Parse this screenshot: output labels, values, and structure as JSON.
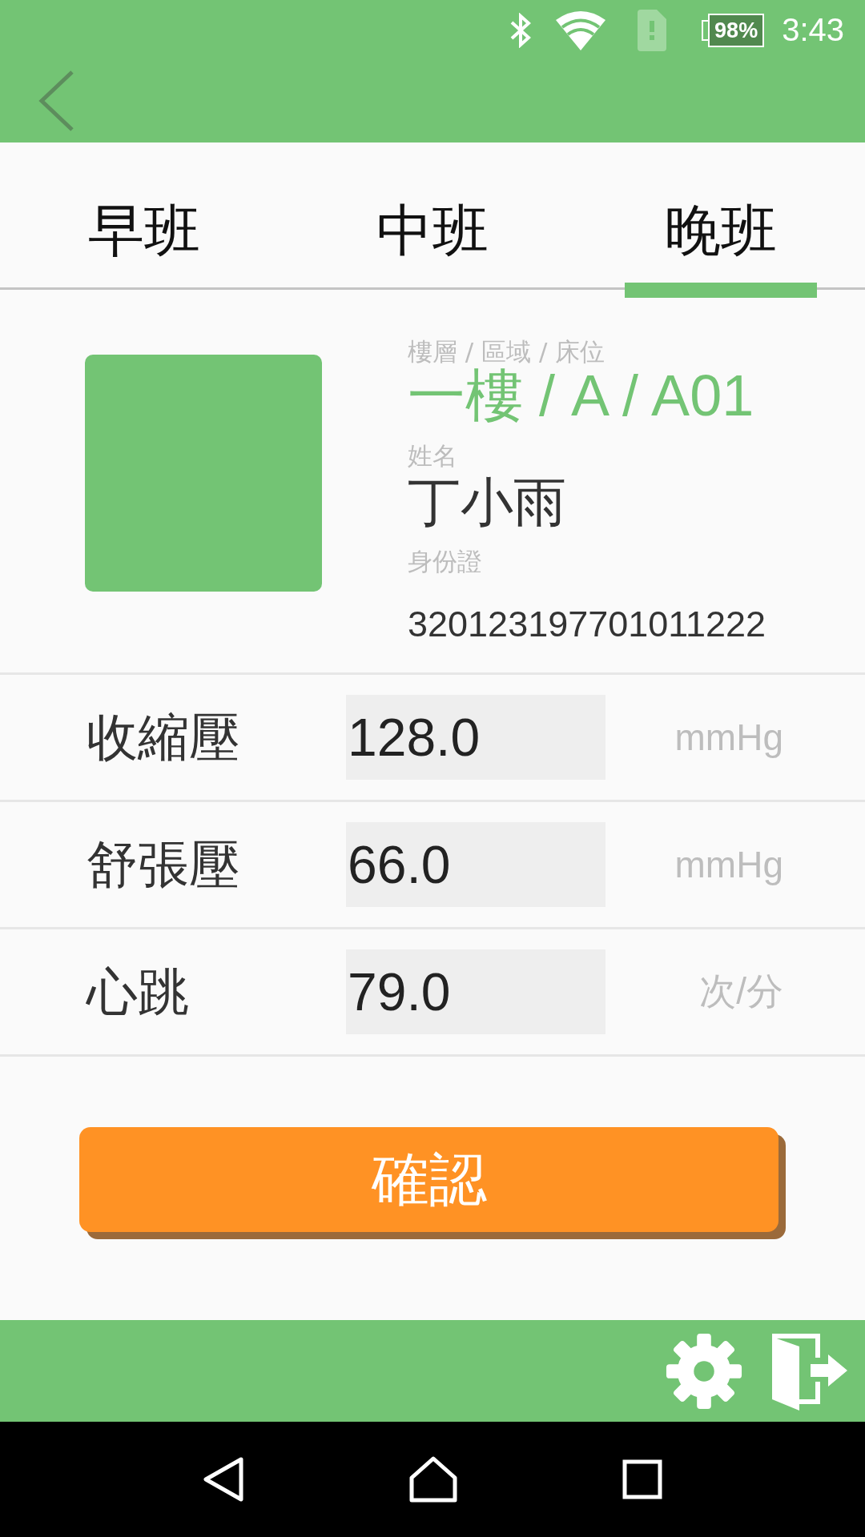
{
  "status_bar": {
    "battery": "98%",
    "time": "3:43"
  },
  "tabs": [
    {
      "label": "早班",
      "selected": false
    },
    {
      "label": "中班",
      "selected": false
    },
    {
      "label": "晚班",
      "selected": true
    }
  ],
  "patient": {
    "location_label": "樓層 / 區域 / 床位",
    "location": "一樓 / A / A01",
    "name_label": "姓名",
    "name": "丁小雨",
    "id_label": "身份證",
    "id": "320123197701011222"
  },
  "vitals": [
    {
      "label": "收縮壓",
      "value": "128.0",
      "unit": "mmHg"
    },
    {
      "label": "舒張壓",
      "value": "66.0",
      "unit": "mmHg"
    },
    {
      "label": "心跳",
      "value": "79.0",
      "unit": "次/分"
    }
  ],
  "confirm_button": "確認"
}
